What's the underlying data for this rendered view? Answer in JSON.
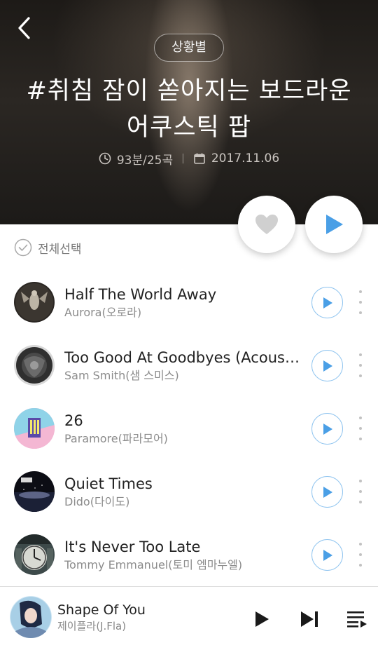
{
  "header": {
    "back_icon": "chevron-left-icon",
    "category": "상황별",
    "title_line1": "#취침 잠이 쏟아지는 보드라운",
    "title_line2": "어쿠스틱 팝",
    "duration_info": "93분/25곡",
    "date": "2017.11.06",
    "separator": "|"
  },
  "actions": {
    "like_icon": "heart-icon",
    "play_all_icon": "play-icon"
  },
  "list": {
    "select_all_label": "전체선택",
    "tracks": [
      {
        "title": "Half The World Away",
        "artist": "Aurora(오로라)"
      },
      {
        "title": "Too Good At Goodbyes (Acoustic)",
        "artist": "Sam Smith(샘 스미스)"
      },
      {
        "title": "26",
        "artist": "Paramore(파라모어)"
      },
      {
        "title": "Quiet Times",
        "artist": "Dido(다이도)"
      },
      {
        "title": "It's Never Too Late",
        "artist": "Tommy Emmanuel(토미 엠마누엘)"
      }
    ]
  },
  "player": {
    "title": "Shape Of You",
    "artist": "제이플라(J.Fla)",
    "play_icon": "play-icon",
    "next_icon": "skip-next-icon",
    "queue_icon": "playlist-icon"
  },
  "colors": {
    "accent_blue": "#4a9fe6",
    "play_ring": "#8fc4ef",
    "heart_gray": "#d0d0d0"
  }
}
